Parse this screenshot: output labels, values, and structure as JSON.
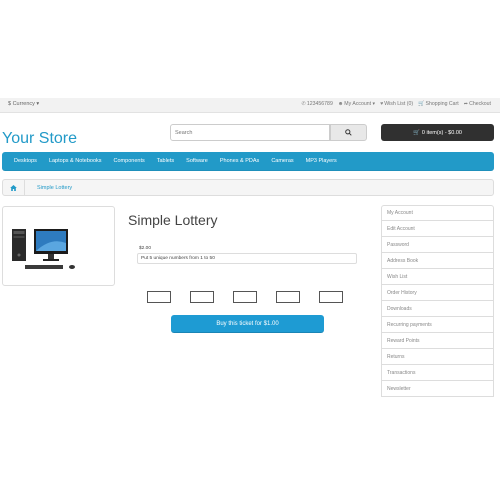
{
  "topbar": {
    "currency": "$ Currency ▾",
    "phone": "123456789",
    "my_account": "My Account ▾",
    "wishlist": "Wish List (0)",
    "cart": "Shopping Cart",
    "checkout": "Checkout"
  },
  "header": {
    "logo": "Your Store",
    "search_placeholder": "Search",
    "cart_button": "0 item(s) - $0.00"
  },
  "menu": [
    "Desktops",
    "Laptops & Notebooks",
    "Components",
    "Tablets",
    "Software",
    "Phones & PDAs",
    "Cameras",
    "MP3 Players"
  ],
  "breadcrumb": {
    "current": "Simple Lottery"
  },
  "product": {
    "title": "Simple Lottery",
    "price": "$2.00",
    "hint": "Put 5 unique numbers from 1 to 50",
    "buy_button": "Buy this ticket for $1.00"
  },
  "sidebar": [
    "My Account",
    "Edit Account",
    "Password",
    "Address Book",
    "Wish List",
    "Order History",
    "Downloads",
    "Recurring payments",
    "Reward Points",
    "Returns",
    "Transactions",
    "Newsletter"
  ],
  "colors": {
    "accent": "#229ac8",
    "button": "#1e9bd3",
    "dark": "#303030"
  }
}
